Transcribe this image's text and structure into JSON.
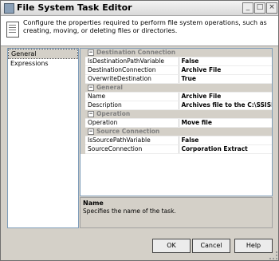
{
  "window": {
    "title": "File System Task Editor"
  },
  "header": {
    "text": "Configure the properties required to perform file system operations, such as creating, moving, or deleting files or directories."
  },
  "nav": {
    "items": [
      {
        "label": "General",
        "selected": true
      },
      {
        "label": "Expressions",
        "selected": false
      }
    ]
  },
  "grid": {
    "categories": [
      {
        "name": "Destination Connection",
        "rows": [
          {
            "name": "IsDestinationPathVariable",
            "value": "False"
          },
          {
            "name": "DestinationConnection",
            "value": "Archive File"
          },
          {
            "name": "OverwriteDestination",
            "value": "True"
          }
        ]
      },
      {
        "name": "General",
        "rows": [
          {
            "name": "Name",
            "value": "Archive File"
          },
          {
            "name": "Description",
            "value": "Archives file to the C:\\SSISDemo\\ar"
          }
        ]
      },
      {
        "name": "Operation",
        "rows": [
          {
            "name": "Operation",
            "value": "Move file"
          }
        ]
      },
      {
        "name": "Source Connection",
        "rows": [
          {
            "name": "IsSourcePathVariable",
            "value": "False"
          },
          {
            "name": "SourceConnection",
            "value": "Corporation Extract"
          }
        ]
      }
    ]
  },
  "description": {
    "title": "Name",
    "text": "Specifies the name of the task."
  },
  "buttons": {
    "ok": "OK",
    "cancel": "Cancel",
    "help": "Help"
  },
  "titlebar_buttons": {
    "minimize": "_",
    "maximize": "□",
    "close": "×"
  }
}
